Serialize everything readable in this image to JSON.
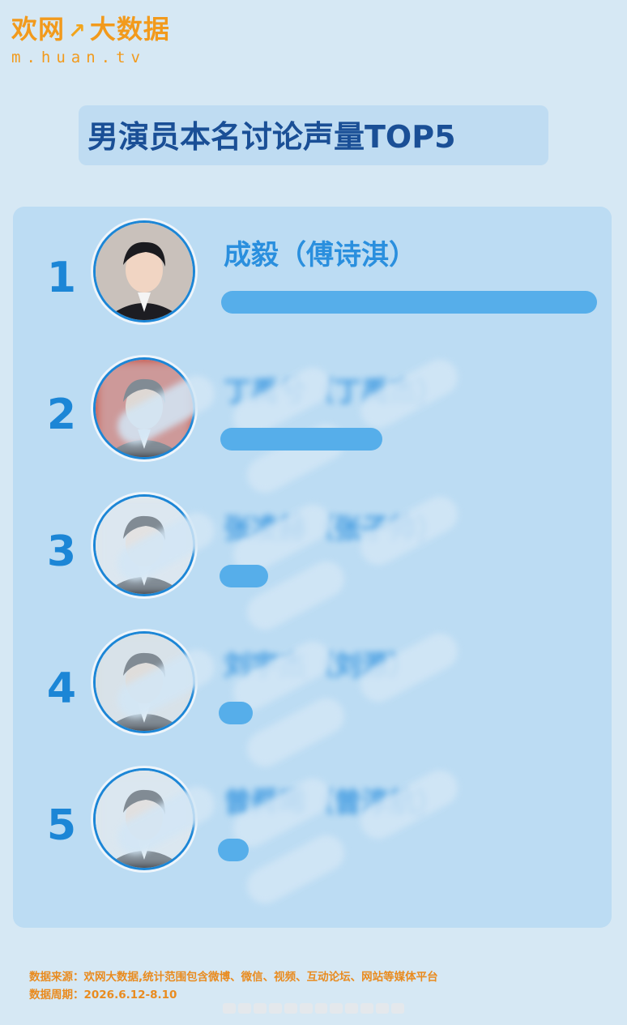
{
  "logo": {
    "text": "欢网",
    "mark": "大数据",
    "url": "m.huan.tv"
  },
  "title": "男演员本名讨论声量TOP5",
  "chart_data": {
    "type": "bar",
    "orientation": "horizontal",
    "title": "男演员本名讨论声量TOP5",
    "categories": [
      "成毅（傅诗淇）",
      "丁禹兮（丁禹杰）",
      "张凌赫（张子帅）",
      "刘宇杰（刘源）",
      "曾舜晞（曾淳航）"
    ],
    "ranks": [
      "1",
      "2",
      "3",
      "4",
      "5"
    ],
    "values": [
      100,
      43,
      13,
      9,
      7
    ],
    "blurred": [
      false,
      true,
      true,
      true,
      true
    ],
    "bar_color": "#56aeea",
    "grid": false,
    "legend": "none"
  },
  "footer": {
    "source": "数据来源：欢网大数据,统计范围包含微博、微信、视频、互动论坛、网站等媒体平台",
    "period": "数据周期：2026.6.12-8.10"
  },
  "colors": {
    "background": "#d6e8f4",
    "panel": "#bcdcf3",
    "rank": "#1c86d6",
    "name": "#2a8fde",
    "title": "#1a4f96",
    "brand": "#f29a1c"
  }
}
